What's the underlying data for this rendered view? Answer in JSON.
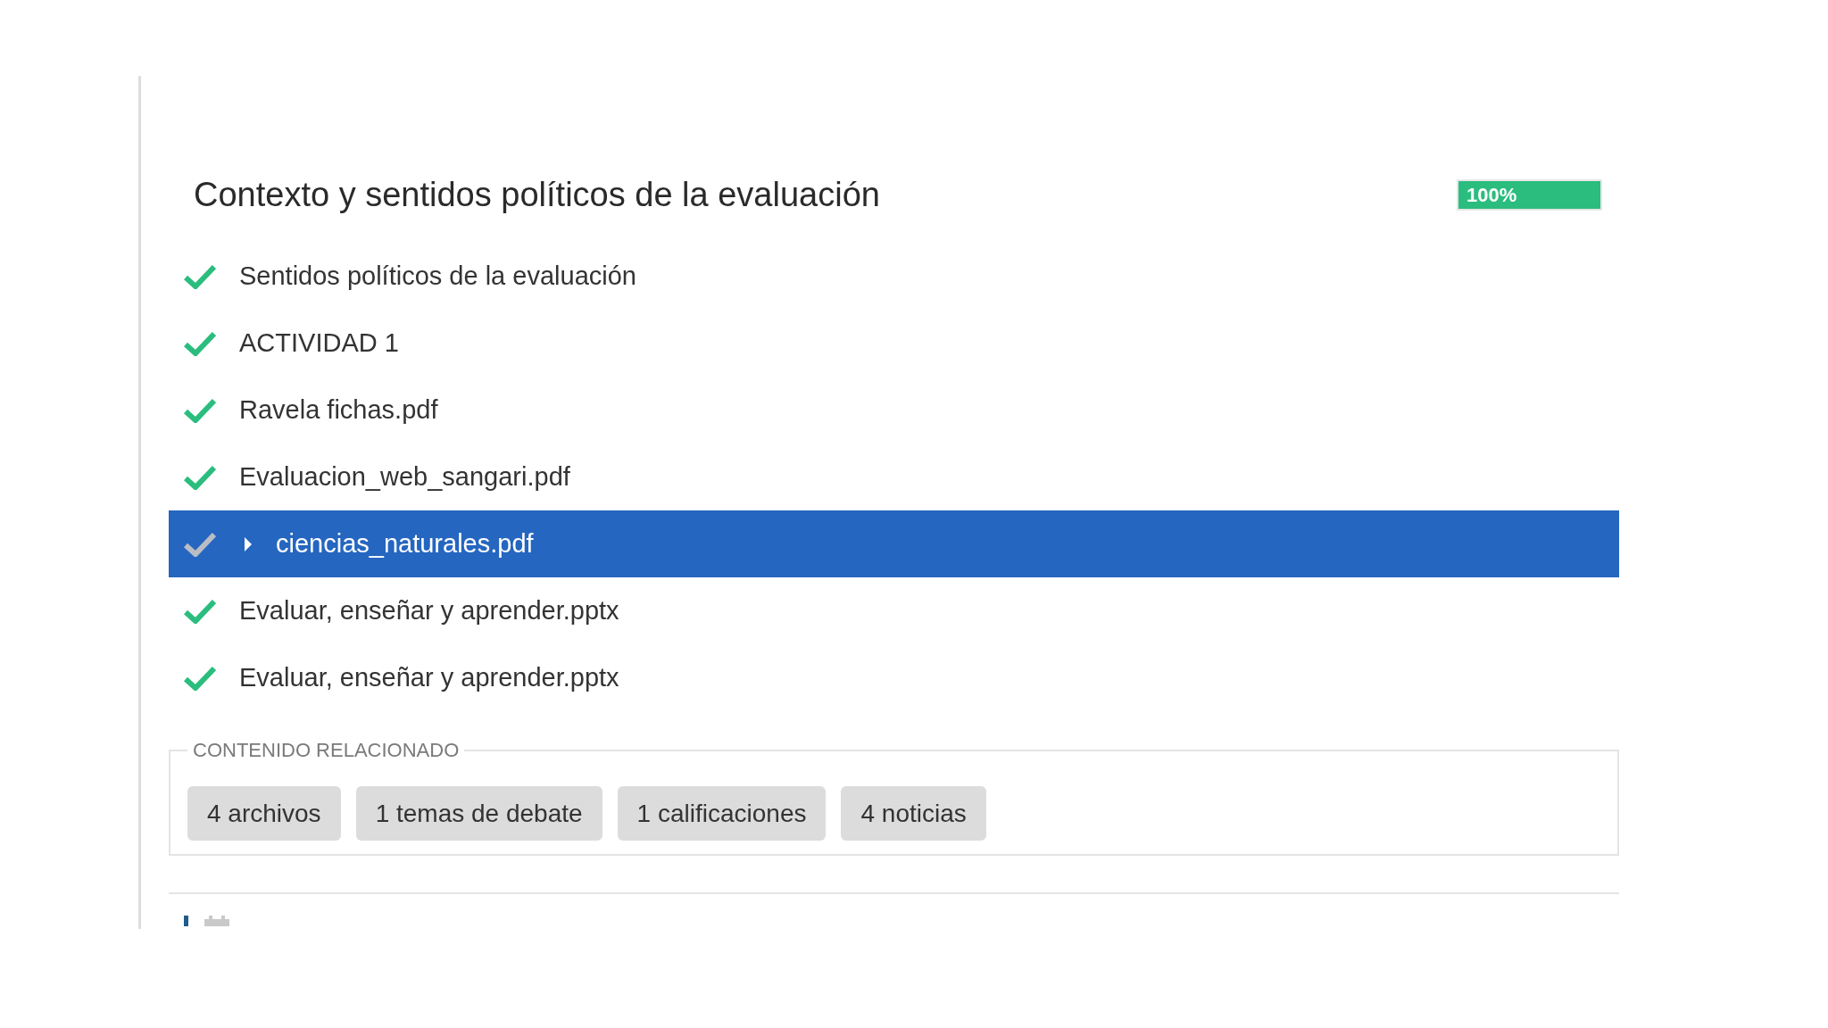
{
  "section": {
    "title": "Contexto y sentidos políticos de la evaluación",
    "progress": {
      "label": "100%",
      "level": 1.0
    }
  },
  "items": [
    {
      "label": "Sentidos políticos de la evaluación",
      "done": true,
      "selected": false
    },
    {
      "label": "ACTIVIDAD 1",
      "done": true,
      "selected": false
    },
    {
      "label": "Ravela fichas.pdf",
      "done": true,
      "selected": false
    },
    {
      "label": "Evaluacion_web_sangari.pdf",
      "done": true,
      "selected": false
    },
    {
      "label": "ciencias_naturales.pdf",
      "done": true,
      "selected": true
    },
    {
      "label": "Evaluar, enseñar y aprender.pptx",
      "done": true,
      "selected": false
    },
    {
      "label": "Evaluar, enseñar y aprender.pptx",
      "done": true,
      "selected": false
    }
  ],
  "related": {
    "legend": "CONTENIDO RELACIONADO",
    "buttons": [
      "4 archivos",
      "1 temas de debate",
      "1 calificaciones",
      "4 noticias"
    ]
  }
}
